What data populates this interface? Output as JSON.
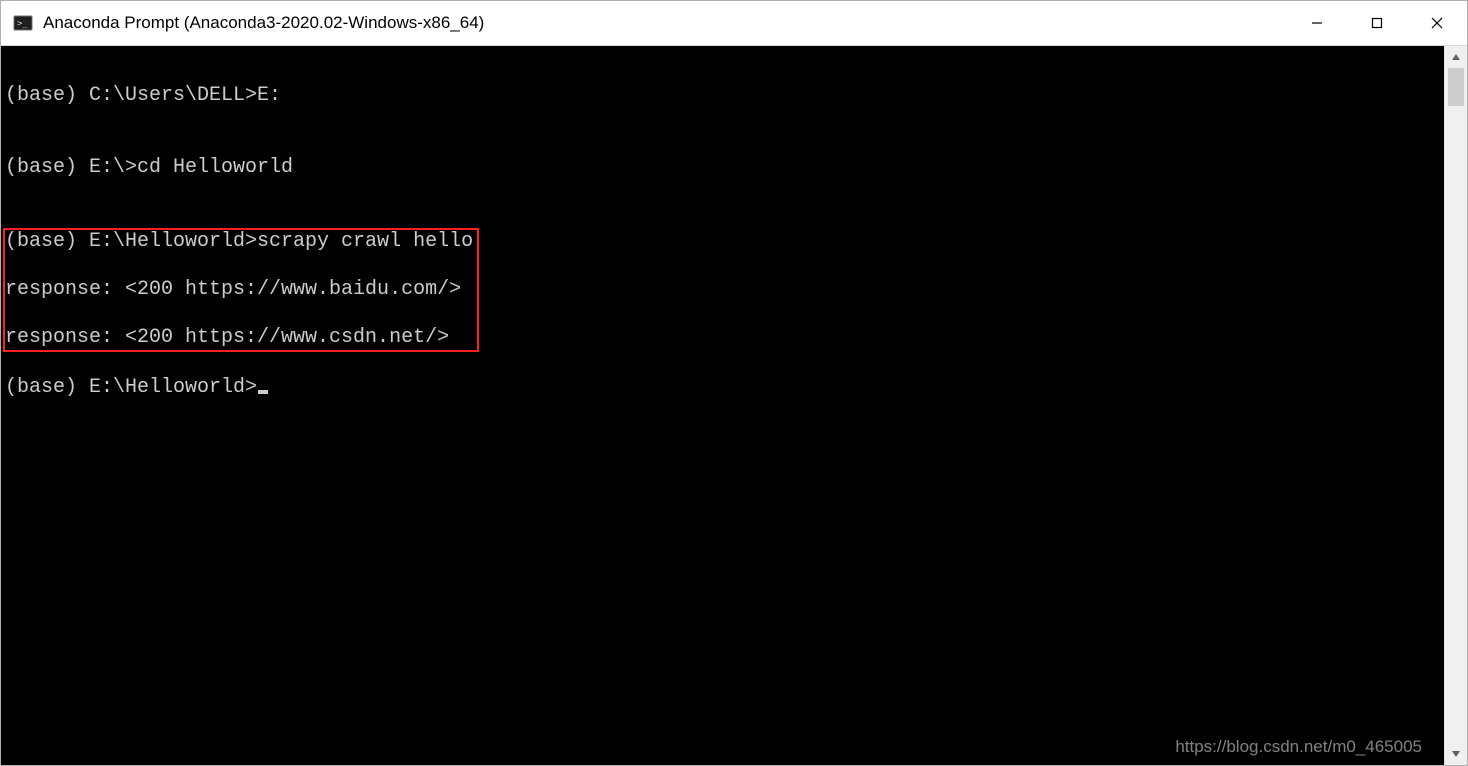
{
  "window": {
    "title": "Anaconda Prompt (Anaconda3-2020.02-Windows-x86_64)"
  },
  "terminal": {
    "lines": {
      "l1": "(base) C:\\Users\\DELL>E:",
      "blank1": "",
      "l2": "(base) E:\\>cd Helloworld",
      "blank2": "",
      "h1": "(base) E:\\Helloworld>scrapy crawl hello",
      "h2": "response: <200 https://www.baidu.com/>",
      "h3": "response: <200 https://www.csdn.net/>",
      "blank3": "",
      "prompt": "(base) E:\\Helloworld>"
    }
  },
  "watermark": "https://blog.csdn.net/m0_465005"
}
